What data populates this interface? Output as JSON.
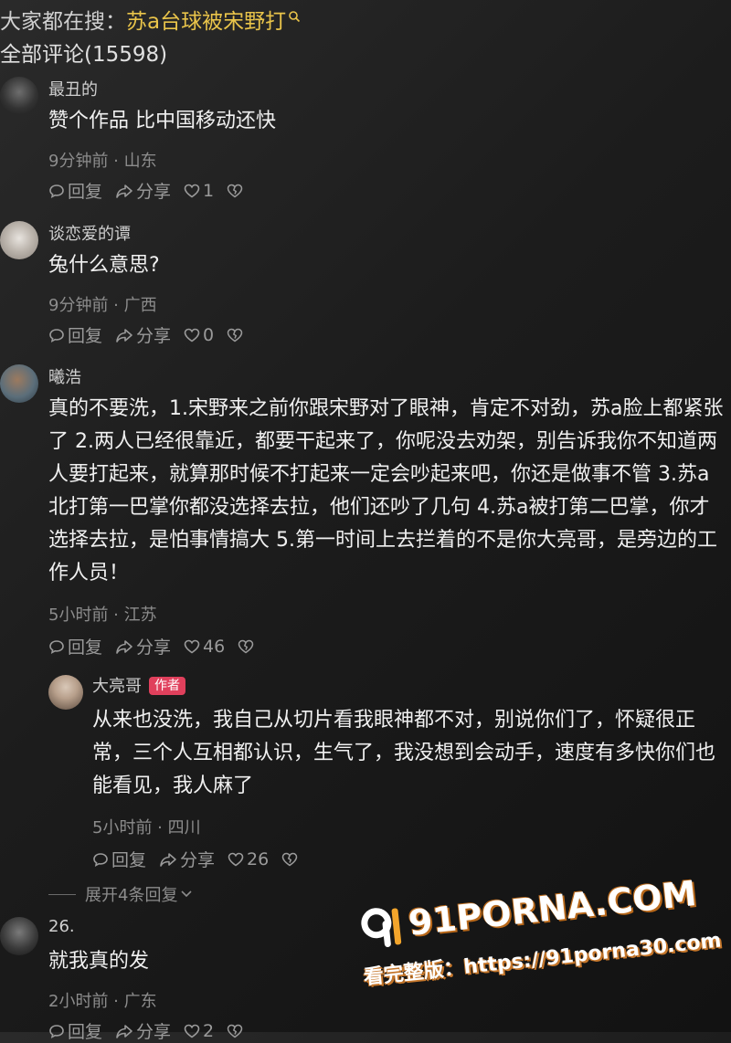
{
  "search": {
    "prefix": "大家都在搜：",
    "query": "苏a台球被宋野打",
    "icon": "search-icon"
  },
  "comment_count": "全部评论(15598)",
  "comments": [
    {
      "user": "最丑的",
      "text": "赞个作品 比中国移动还快",
      "meta": "9分钟前 · 山东",
      "reply": "回复",
      "share": "分享",
      "likes": "1"
    },
    {
      "user": "谈恋爱的谭",
      "text": "兔什么意思?",
      "meta": "9分钟前 · 广西",
      "reply": "回复",
      "share": "分享",
      "likes": "0"
    },
    {
      "user": "曦浩",
      "text": "真的不要洗，1.宋野来之前你跟宋野对了眼神，肯定不对劲，苏a脸上都紧张了 2.两人已经很靠近，都要干起来了，你呢没去劝架，别告诉我你不知道两人要打起来，就算那时候不打起来一定会吵起来吧，你还是做事不管 3.苏a北打第一巴掌你都没选择去拉，他们还吵了几句 4.苏a被打第二巴掌，你才选择去拉，是怕事情搞大 5.第一时间上去拦着的不是你大亮哥，是旁边的工作人员！",
      "meta": "5小时前 · 江苏",
      "reply": "回复",
      "share": "分享",
      "likes": "46"
    },
    {
      "user": "26.",
      "text": "就我真的发",
      "meta": "2小时前 · 广东",
      "reply": "回复",
      "share": "分享",
      "likes": "2"
    }
  ],
  "reply": {
    "user": "大亮哥",
    "badge": "作者",
    "text": "从来也没洗，我自己从切片看我眼神都不对，别说你们了，怀疑很正常，三个人互相都认识，生气了，我没想到会动手，速度有多快你们也能看见，我人麻了",
    "meta": "5小时前 · 四川",
    "reply": "回复",
    "share": "分享",
    "likes": "26"
  },
  "expand_replies": "展开4条回复",
  "watermark": {
    "logo": "91PORNA.COM",
    "line": "看完整版：https://91porna30.com",
    "accent": "#f3a52b"
  }
}
